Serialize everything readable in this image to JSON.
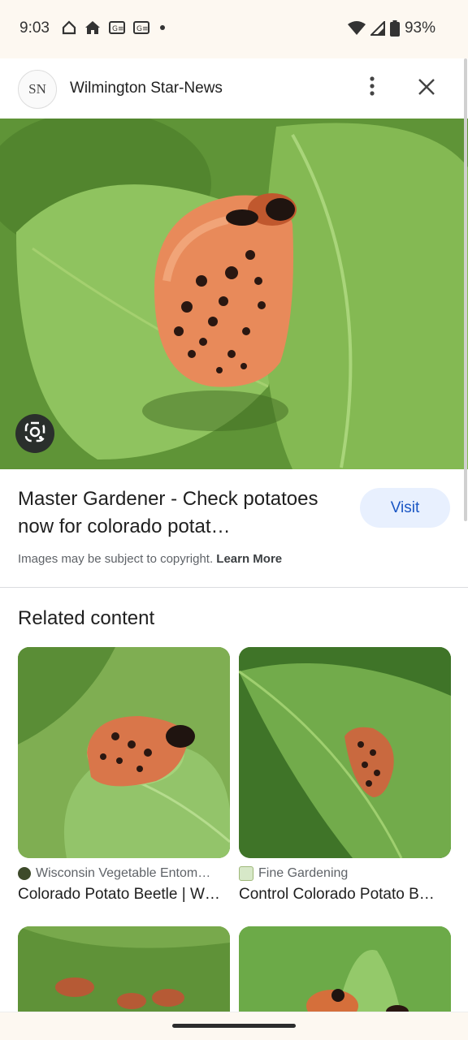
{
  "status": {
    "time": "9:03",
    "battery": "93%",
    "icons_left": [
      "home-outline-icon",
      "home-icon",
      "gmail-icon",
      "gmail-icon",
      "dot-icon"
    ],
    "icons_right": [
      "wifi-icon",
      "signal-icon",
      "battery-icon"
    ]
  },
  "header": {
    "avatar_text": "SN",
    "site_name": "Wilmington Star-News"
  },
  "result": {
    "title": "Master Gardener - Check potatoes now for colorado potat…",
    "visit_label": "Visit",
    "copyright_text": "Images may be subject to copyright.",
    "learn_more": "Learn More"
  },
  "related": {
    "heading": "Related content",
    "items": [
      {
        "source": "Wisconsin Vegetable Entom…",
        "title": "Colorado Potato Beetle | W…"
      },
      {
        "source": "Fine Gardening",
        "title": "Control Colorado Potato B…"
      }
    ]
  },
  "colors": {
    "accent": "#1a56c4",
    "visit_bg": "#e8f0fe",
    "status_bg": "#fdf8f1"
  }
}
